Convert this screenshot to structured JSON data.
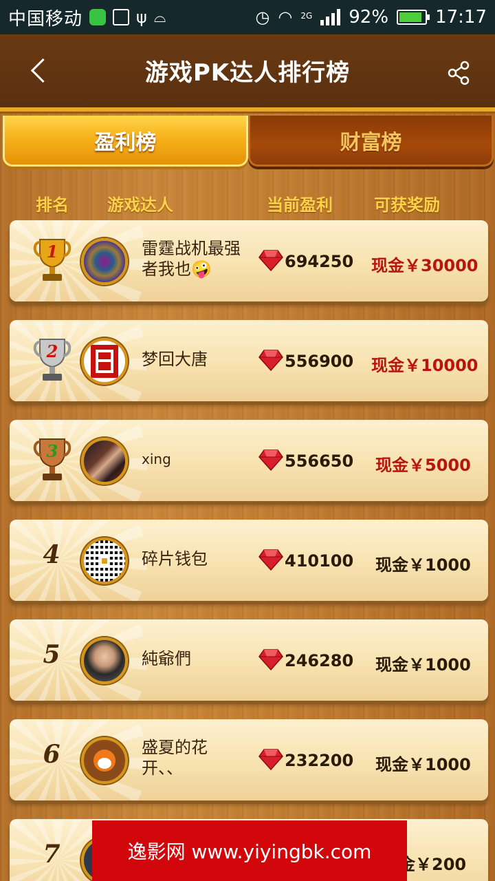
{
  "status_bar": {
    "carrier": "中国移动",
    "network": "2G",
    "battery": "92%",
    "time": "17:17"
  },
  "header": {
    "title": "游戏PK达人排行榜",
    "back_icon": "chevron-left-icon",
    "share_icon": "share-icon"
  },
  "tabs": [
    {
      "label": "盈利榜",
      "active": true
    },
    {
      "label": "财富榜",
      "active": false
    }
  ],
  "columns": {
    "rank": "排名",
    "player": "游戏达人",
    "profit": "当前盈利",
    "reward": "可获奖励"
  },
  "rows": [
    {
      "rank": "1",
      "trophy": "gold",
      "name": "雷霆战机最强者我也🤪",
      "profit": "694250",
      "reward": "现金￥30000"
    },
    {
      "rank": "2",
      "trophy": "silver",
      "name": "梦回大唐",
      "profit": "556900",
      "reward": "现金￥10000"
    },
    {
      "rank": "3",
      "trophy": "bronze",
      "name": "xing",
      "profit": "556650",
      "reward": "现金￥5000"
    },
    {
      "rank": "4",
      "trophy": "",
      "name": "碎片钱包",
      "profit": "410100",
      "reward": "现金￥1000"
    },
    {
      "rank": "5",
      "trophy": "",
      "name": "純爺們",
      "profit": "246280",
      "reward": "现金￥1000"
    },
    {
      "rank": "6",
      "trophy": "",
      "name": "盛夏的花开、、",
      "profit": "232200",
      "reward": "现金￥1000"
    },
    {
      "rank": "7",
      "trophy": "",
      "name": "",
      "profit": "",
      "reward": "金￥200"
    }
  ],
  "colors": {
    "reward_top": "#b8150e",
    "reward_other": "#2a1a08",
    "gem": "#d81e2a"
  },
  "banner": {
    "text": "逸影网 www.yiyingbk.com"
  }
}
